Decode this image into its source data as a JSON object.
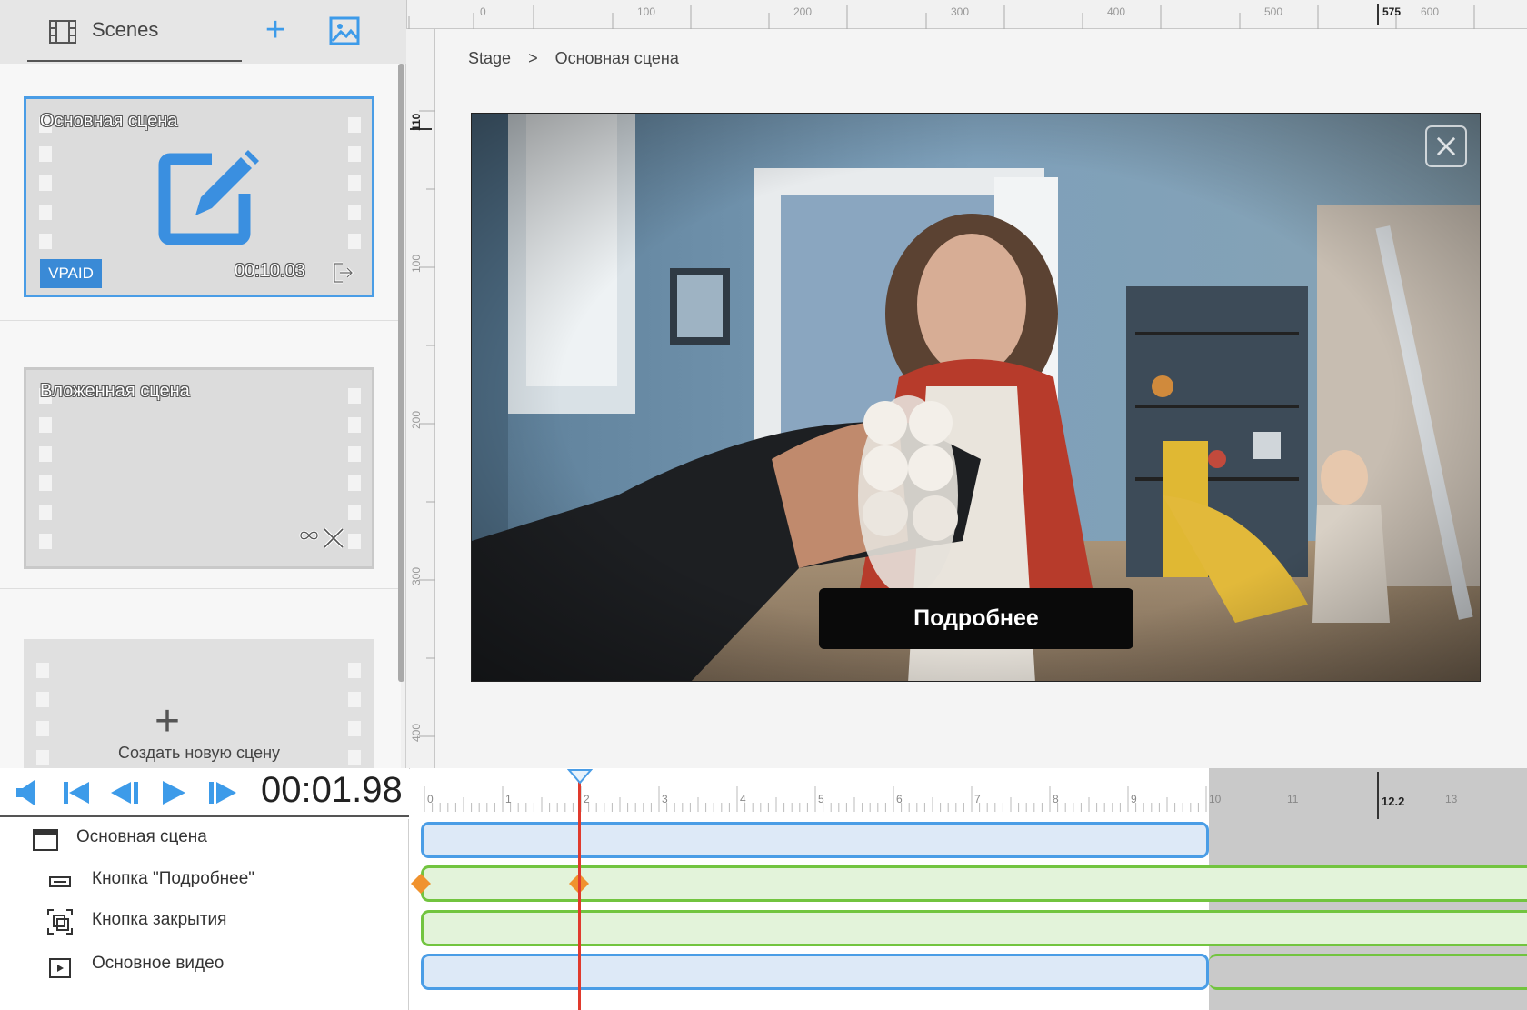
{
  "scenes_panel": {
    "title": "Scenes",
    "add_button": "+",
    "cards": [
      {
        "title": "Основная сцена",
        "badge": "VPAID",
        "duration": "00:10.03"
      },
      {
        "title": "Вложенная сцена"
      }
    ],
    "new_scene": {
      "plus": "+",
      "label": "Создать новую сцену"
    }
  },
  "ruler_top": {
    "labels": [
      "0",
      "100",
      "200",
      "300",
      "400",
      "500",
      "575",
      "600"
    ]
  },
  "ruler_left": {
    "labels": [
      "110",
      "100",
      "200",
      "300",
      "400"
    ]
  },
  "breadcrumb": {
    "root": "Stage",
    "separator": ">",
    "current": "Основная сцена"
  },
  "stage": {
    "cta_label": "Подробнее",
    "close_icon": "close-icon"
  },
  "timeline": {
    "time": "00:01.98",
    "ruler_labels": [
      "0",
      "1",
      "2",
      "3",
      "4",
      "5",
      "6",
      "7",
      "8",
      "9",
      "10",
      "11",
      "12.2",
      "13"
    ],
    "tracks": [
      {
        "label": "Основная сцена",
        "icon": "window-icon"
      },
      {
        "label": "Кнопка \"Подробнее\"",
        "icon": "button-icon"
      },
      {
        "label": "Кнопка закрытия",
        "icon": "close-button-icon"
      },
      {
        "label": "Основное видео",
        "icon": "video-icon"
      }
    ]
  },
  "colors": {
    "accent": "#3d9be9",
    "playhead": "#e03a2d",
    "keyframe": "#f0922e",
    "track_green": "#72c43f"
  }
}
